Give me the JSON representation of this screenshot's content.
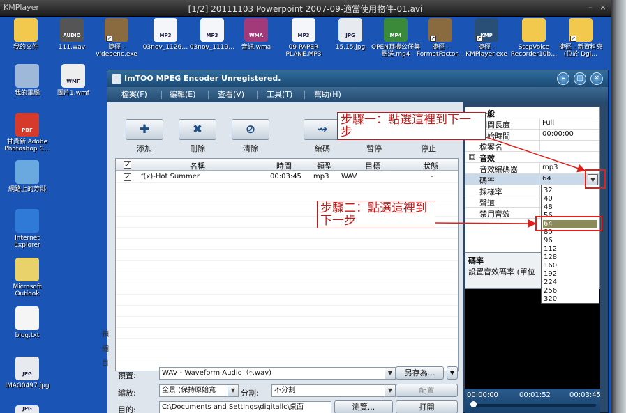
{
  "kmplayer": {
    "logo": "KMPlayer",
    "title": "[1/2] 20111103 Powerpoint 2007-09-適當使用物件-01.avi",
    "minimize": "–",
    "close": "×"
  },
  "desktop": {
    "top_icons": [
      {
        "label": "我的文件",
        "icon": "folder-documents-icon"
      },
      {
        "label": "111.wav",
        "icon": "audio-file-icon",
        "badge": "AUDIO"
      },
      {
        "label": "捷徑 - videoenc.exe",
        "icon": "shortcut-app-icon"
      },
      {
        "label": "03nov_1126…",
        "icon": "mp3-file-icon",
        "badge": "MP3"
      },
      {
        "label": "03nov_1119…",
        "icon": "mp3-file-icon",
        "badge": "MP3"
      },
      {
        "label": "音訊.wma",
        "icon": "wma-file-icon",
        "badge": "WMA"
      },
      {
        "label": "09 PAPER PLANE.MP3",
        "icon": "mp3-file-icon",
        "badge": "MP3"
      },
      {
        "label": "15.15.jpg",
        "icon": "jpg-file-icon",
        "badge": "JPG"
      },
      {
        "label": "OPEN耳機公仔集點送.mp4",
        "icon": "mp4-file-icon",
        "badge": "MP4"
      },
      {
        "label": "捷徑 - FormatFactor…",
        "icon": "shortcut-app-icon"
      },
      {
        "label": "捷徑 - KMPlayer.exe",
        "icon": "shortcut-kmp-icon",
        "badge": "KMP"
      },
      {
        "label": "StepVoice Recorder10b…",
        "icon": "folder-icon"
      },
      {
        "label": "捷徑 - 新資料夾 (位於 Dgl…",
        "icon": "shortcut-folder-icon"
      }
    ],
    "left_icons": [
      {
        "label": "我的電腦",
        "icon": "my-computer-icon"
      },
      {
        "label": "圖片1.wmf",
        "icon": "wmf-file-icon",
        "badge": "WMF"
      },
      {
        "label": "甘貴新 Adobe Photoshop C…",
        "icon": "pdf-file-icon",
        "badge": "PDF"
      },
      {
        "label": "網路上的芳鄰",
        "icon": "network-icon"
      },
      {
        "label": "Internet Explorer",
        "icon": "ie-icon"
      },
      {
        "label": "Microsoft Outlook",
        "icon": "outlook-icon"
      },
      {
        "label": "blog.txt",
        "icon": "text-file-icon"
      },
      {
        "label": "IMAG0497.jpg",
        "icon": "jpg-file-icon",
        "badge": "JPG"
      }
    ],
    "partial_bottom_badge": "JPG"
  },
  "app": {
    "title": "ImTOO MPEG Encoder Unregistered.",
    "menu": [
      "檔案(F)",
      "編輯(E)",
      "查看(V)",
      "工具(T)",
      "幫助(H)"
    ],
    "toolbar": [
      {
        "label": "添加",
        "glyph": "✚",
        "icon": "add-icon"
      },
      {
        "label": "刪除",
        "glyph": "✖",
        "icon": "delete-icon"
      },
      {
        "label": "清除",
        "glyph": "⊘",
        "icon": "clear-icon"
      },
      {
        "label": "編碼",
        "glyph": "⇝",
        "icon": "encode-icon"
      },
      {
        "label": "暫停",
        "glyph": "",
        "icon": "pause-icon"
      },
      {
        "label": "停止",
        "glyph": "",
        "icon": "stop-icon"
      }
    ],
    "columns": [
      "名稱",
      "時間",
      "類型",
      "目標",
      "狀態"
    ],
    "rows": [
      {
        "name": "f(x)-Hot Summer",
        "time": "00:03:45",
        "type": "mp3",
        "target": "WAV",
        "status": "-"
      }
    ],
    "side_clipped_chars": [
      "預",
      "縮",
      "目"
    ],
    "form": {
      "preset_label": "預置:",
      "preset_value": "WAV - Waveform Audio（*.wav)",
      "save_as": "另存為...",
      "zoom_label": "縮放:",
      "zoom_value": "全景 (保持原始寬",
      "split_label": "分割:",
      "split_value": "不分割",
      "config": "配置",
      "dest_label": "目的:",
      "dest_value": "C:\\Documents and Settings\\digitallc\\桌面",
      "browse": "瀏覽...",
      "open": "打開"
    },
    "properties": {
      "general_group": "一般",
      "general_rows": [
        {
          "key": "期間長度",
          "value": "Full"
        },
        {
          "key": "開始時間",
          "value": "00:00:00"
        },
        {
          "key": "檔案名",
          "value": ""
        }
      ],
      "audio_group": "音效",
      "audio_rows": [
        {
          "key": "音效編碼器",
          "value": "mp3"
        },
        {
          "key": "碼率",
          "value": "64"
        },
        {
          "key": "採樣率",
          "value": ""
        },
        {
          "key": "聲道",
          "value": ""
        },
        {
          "key": "禁用音效",
          "value": ""
        }
      ],
      "collapse_glyph": "⊟"
    },
    "description": {
      "title": "碼率",
      "text": "設置音效碼率 (單位"
    },
    "bitrate_options": [
      "32",
      "40",
      "48",
      "56",
      "64",
      "80",
      "96",
      "112",
      "128",
      "160",
      "192",
      "224",
      "256",
      "320"
    ],
    "bitrate_selected": "64",
    "seek": {
      "start": "00:00:00",
      "mid": "00:01:52",
      "end": "00:03:45",
      "position_fraction": 0.0
    }
  },
  "annotations": {
    "step1": "步驟一：點選這裡到下一步",
    "step2": "步驟二：點選這裡到下一步",
    "color": "#c41a1a"
  }
}
